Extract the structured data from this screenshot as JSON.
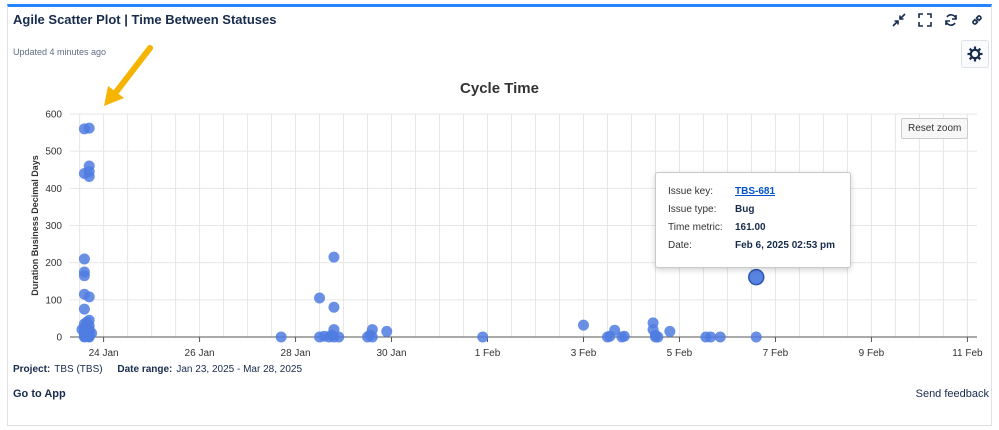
{
  "header": {
    "title": "Agile Scatter Plot | Time Between Statuses",
    "updated": "Updated 4 minutes ago"
  },
  "toolbar": {
    "icons": [
      "collapse-icon",
      "fullscreen-icon",
      "refresh-icon",
      "link-icon"
    ],
    "settings_icon": "gear-icon"
  },
  "chart_controls": {
    "reset_zoom": "Reset zoom"
  },
  "tooltip": {
    "issue_key_label": "Issue key:",
    "issue_key": "TBS-681",
    "issue_type_label": "Issue type:",
    "issue_type": "Bug",
    "time_metric_label": "Time metric:",
    "time_metric": "161.00",
    "date_label": "Date:",
    "date": "Feb 6, 2025 02:53 pm"
  },
  "footer": {
    "project_label": "Project:",
    "project": "TBS (TBS)",
    "date_range_label": "Date range:",
    "date_range": "Jan 23, 2025 - Mar 28, 2025",
    "go_to_app": "Go to App",
    "send_feedback": "Send feedback"
  },
  "colors": {
    "accent": "#2684ff",
    "point": "#4f7de0",
    "grid": "#e6e6e6"
  },
  "chart_data": {
    "type": "scatter",
    "title": "Cycle Time",
    "xlabel": "",
    "ylabel": "Duration Business Decimal Days",
    "x_unit": "days since 23 Jan 2025",
    "xlim": [
      23.3,
      42.2
    ],
    "ylim": [
      0,
      600
    ],
    "x_tick_values": [
      24,
      26,
      28,
      30,
      32,
      34,
      36,
      38,
      40,
      42
    ],
    "x_tick_labels": [
      "24 Jan",
      "26 Jan",
      "28 Jan",
      "30 Jan",
      "1 Feb",
      "3 Feb",
      "5 Feb",
      "7 Feb",
      "9 Feb",
      "11 Feb"
    ],
    "y_ticks": [
      0,
      100,
      200,
      300,
      400,
      500,
      600
    ],
    "grid": true,
    "points": [
      [
        23.6,
        560
      ],
      [
        23.7,
        562
      ],
      [
        23.6,
        440
      ],
      [
        23.7,
        460
      ],
      [
        23.7,
        445
      ],
      [
        23.7,
        432
      ],
      [
        23.6,
        210
      ],
      [
        23.6,
        175
      ],
      [
        23.6,
        165
      ],
      [
        23.6,
        115
      ],
      [
        23.7,
        108
      ],
      [
        23.6,
        75
      ],
      [
        23.7,
        45
      ],
      [
        23.6,
        35
      ],
      [
        23.7,
        30
      ],
      [
        23.6,
        25
      ],
      [
        23.7,
        20
      ],
      [
        23.6,
        15
      ],
      [
        23.7,
        12
      ],
      [
        23.6,
        8
      ],
      [
        23.7,
        5
      ],
      [
        23.6,
        2
      ],
      [
        23.7,
        1
      ],
      [
        23.6,
        0
      ],
      [
        23.7,
        0
      ],
      [
        23.55,
        20
      ],
      [
        23.75,
        10
      ],
      [
        23.65,
        40
      ],
      [
        27.7,
        0
      ],
      [
        28.5,
        105
      ],
      [
        28.5,
        0
      ],
      [
        28.6,
        2
      ],
      [
        28.7,
        0
      ],
      [
        28.75,
        5
      ],
      [
        28.8,
        215
      ],
      [
        28.8,
        80
      ],
      [
        28.8,
        20
      ],
      [
        28.8,
        0
      ],
      [
        28.9,
        0
      ],
      [
        29.5,
        0
      ],
      [
        29.55,
        5
      ],
      [
        29.6,
        20
      ],
      [
        29.6,
        0
      ],
      [
        29.9,
        15
      ],
      [
        31.9,
        0
      ],
      [
        34.0,
        32
      ],
      [
        34.5,
        0
      ],
      [
        34.55,
        2
      ],
      [
        34.65,
        18
      ],
      [
        34.8,
        0
      ],
      [
        34.85,
        2
      ],
      [
        35.45,
        38
      ],
      [
        35.45,
        20
      ],
      [
        35.5,
        5
      ],
      [
        35.5,
        0
      ],
      [
        35.55,
        0
      ],
      [
        35.8,
        15
      ],
      [
        36.55,
        0
      ],
      [
        36.65,
        0
      ],
      [
        36.85,
        0
      ],
      [
        37.6,
        0
      ],
      [
        37.6,
        161
      ]
    ],
    "highlight_index": 61
  }
}
